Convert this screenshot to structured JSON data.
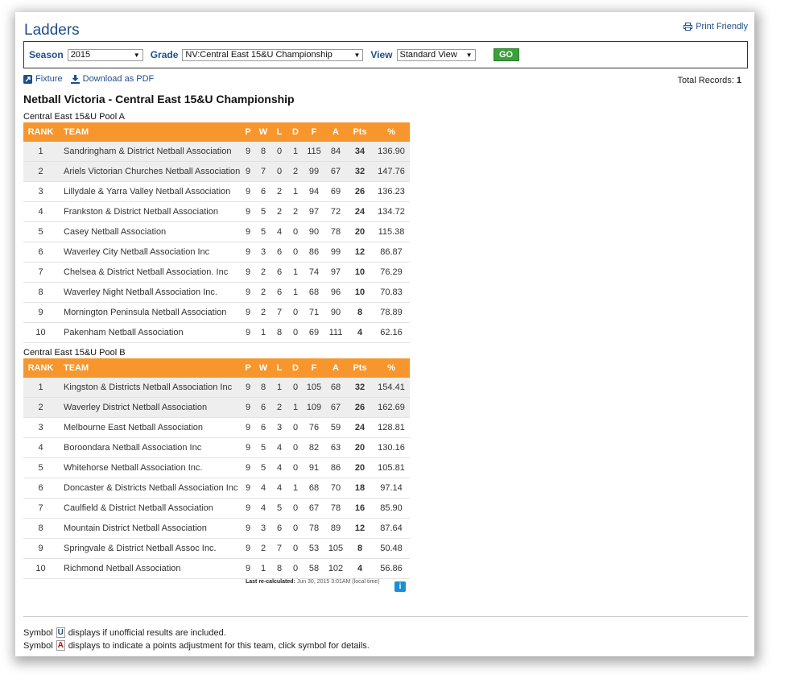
{
  "page_title": "Ladders",
  "print_label": "Print Friendly",
  "filters": {
    "season_label": "Season",
    "season_value": "2015",
    "grade_label": "Grade",
    "grade_value": "NV:Central East 15&U Championship",
    "view_label": "View",
    "view_value": "Standard View",
    "go_label": "GO"
  },
  "links": {
    "fixture": "Fixture",
    "download": "Download as PDF"
  },
  "total_records": {
    "label": "Total Records:",
    "value": "1"
  },
  "heading": "Netball Victoria - Central East 15&U Championship",
  "columns": [
    "RANK",
    "TEAM",
    "P",
    "W",
    "L",
    "D",
    "F",
    "A",
    "Pts",
    "%"
  ],
  "pools": [
    {
      "name": "Central East 15&U Pool A",
      "rows": [
        [
          "1",
          "Sandringham & District Netball Association",
          "9",
          "8",
          "0",
          "1",
          "115",
          "84",
          "34",
          "136.90"
        ],
        [
          "2",
          "Ariels Victorian Churches Netball Association",
          "9",
          "7",
          "0",
          "2",
          "99",
          "67",
          "32",
          "147.76"
        ],
        [
          "3",
          "Lillydale & Yarra Valley Netball Association",
          "9",
          "6",
          "2",
          "1",
          "94",
          "69",
          "26",
          "136.23"
        ],
        [
          "4",
          "Frankston & District Netball Association",
          "9",
          "5",
          "2",
          "2",
          "97",
          "72",
          "24",
          "134.72"
        ],
        [
          "5",
          "Casey Netball Association",
          "9",
          "5",
          "4",
          "0",
          "90",
          "78",
          "20",
          "115.38"
        ],
        [
          "6",
          "Waverley City Netball Association Inc",
          "9",
          "3",
          "6",
          "0",
          "86",
          "99",
          "12",
          "86.87"
        ],
        [
          "7",
          "Chelsea & District Netball Association. Inc",
          "9",
          "2",
          "6",
          "1",
          "74",
          "97",
          "10",
          "76.29"
        ],
        [
          "8",
          "Waverley Night Netball Association Inc.",
          "9",
          "2",
          "6",
          "1",
          "68",
          "96",
          "10",
          "70.83"
        ],
        [
          "9",
          "Mornington Peninsula Netball Association",
          "9",
          "2",
          "7",
          "0",
          "71",
          "90",
          "8",
          "78.89"
        ],
        [
          "10",
          "Pakenham Netball Association",
          "9",
          "1",
          "8",
          "0",
          "69",
          "111",
          "4",
          "62.16"
        ]
      ]
    },
    {
      "name": "Central East 15&U Pool B",
      "rows": [
        [
          "1",
          "Kingston & Districts Netball Association Inc",
          "9",
          "8",
          "1",
          "0",
          "105",
          "68",
          "32",
          "154.41"
        ],
        [
          "2",
          "Waverley District Netball Association",
          "9",
          "6",
          "2",
          "1",
          "109",
          "67",
          "26",
          "162.69"
        ],
        [
          "3",
          "Melbourne East Netball Association",
          "9",
          "6",
          "3",
          "0",
          "76",
          "59",
          "24",
          "128.81"
        ],
        [
          "4",
          "Boroondara Netball Association Inc",
          "9",
          "5",
          "4",
          "0",
          "82",
          "63",
          "20",
          "130.16"
        ],
        [
          "5",
          "Whitehorse Netball Association Inc.",
          "9",
          "5",
          "4",
          "0",
          "91",
          "86",
          "20",
          "105.81"
        ],
        [
          "6",
          "Doncaster & Districts Netball Association Inc",
          "9",
          "4",
          "4",
          "1",
          "68",
          "70",
          "18",
          "97.14"
        ],
        [
          "7",
          "Caulfield & District Netball Association",
          "9",
          "4",
          "5",
          "0",
          "67",
          "78",
          "16",
          "85.90"
        ],
        [
          "8",
          "Mountain District Netball Association",
          "9",
          "3",
          "6",
          "0",
          "78",
          "89",
          "12",
          "87.64"
        ],
        [
          "9",
          "Springvale & District Netball Assoc Inc.",
          "9",
          "2",
          "7",
          "0",
          "53",
          "105",
          "8",
          "50.48"
        ],
        [
          "10",
          "Richmond Netball Association",
          "9",
          "1",
          "8",
          "0",
          "58",
          "102",
          "4",
          "56.86"
        ]
      ]
    }
  ],
  "recalc": {
    "label": "Last re-calculated:",
    "value": "Jun 30, 2015 3:01AM (local time)"
  },
  "info_icon": "i",
  "symbols": {
    "u": {
      "prefix": "Symbol",
      "badge": "U",
      "text": "displays if unofficial results are included."
    },
    "a": {
      "prefix": "Symbol",
      "badge": "A",
      "text": "displays to indicate a points adjustment for this team, click symbol for details."
    }
  }
}
